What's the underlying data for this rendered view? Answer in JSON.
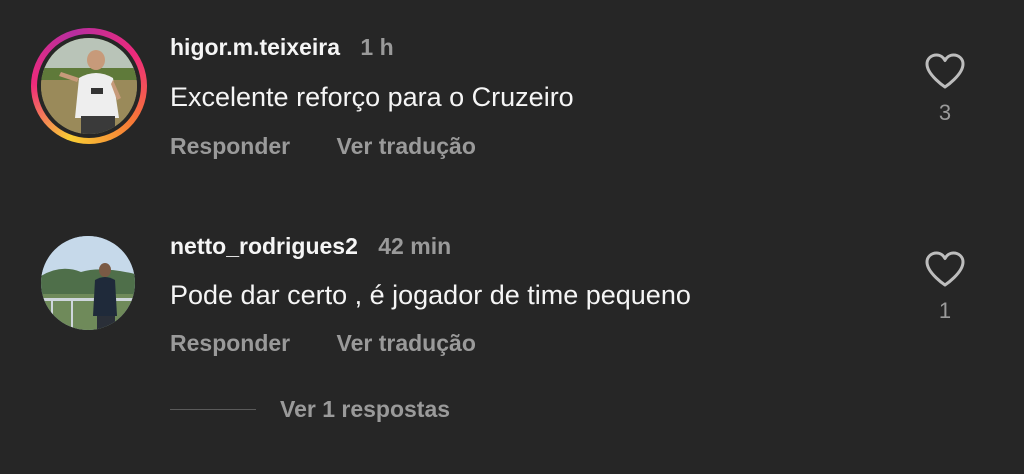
{
  "comments": [
    {
      "username": "higor.m.teixeira",
      "time": "1 h",
      "text": "Excelente reforço para o Cruzeiro",
      "reply_label": "Responder",
      "translate_label": "Ver tradução",
      "likes": "3",
      "has_story_ring": true
    },
    {
      "username": "netto_rodrigues2",
      "time": "42 min",
      "text": "Pode dar certo , é jogador de time pequeno",
      "reply_label": "Responder",
      "translate_label": "Ver tradução",
      "likes": "1",
      "has_story_ring": false
    }
  ],
  "view_replies_label": "Ver 1 respostas",
  "colors": {
    "background": "#262626",
    "primary_text": "#f5f5f5",
    "secondary_text": "#9a9a9a"
  },
  "icons": {
    "like": "heart-outline-icon"
  }
}
